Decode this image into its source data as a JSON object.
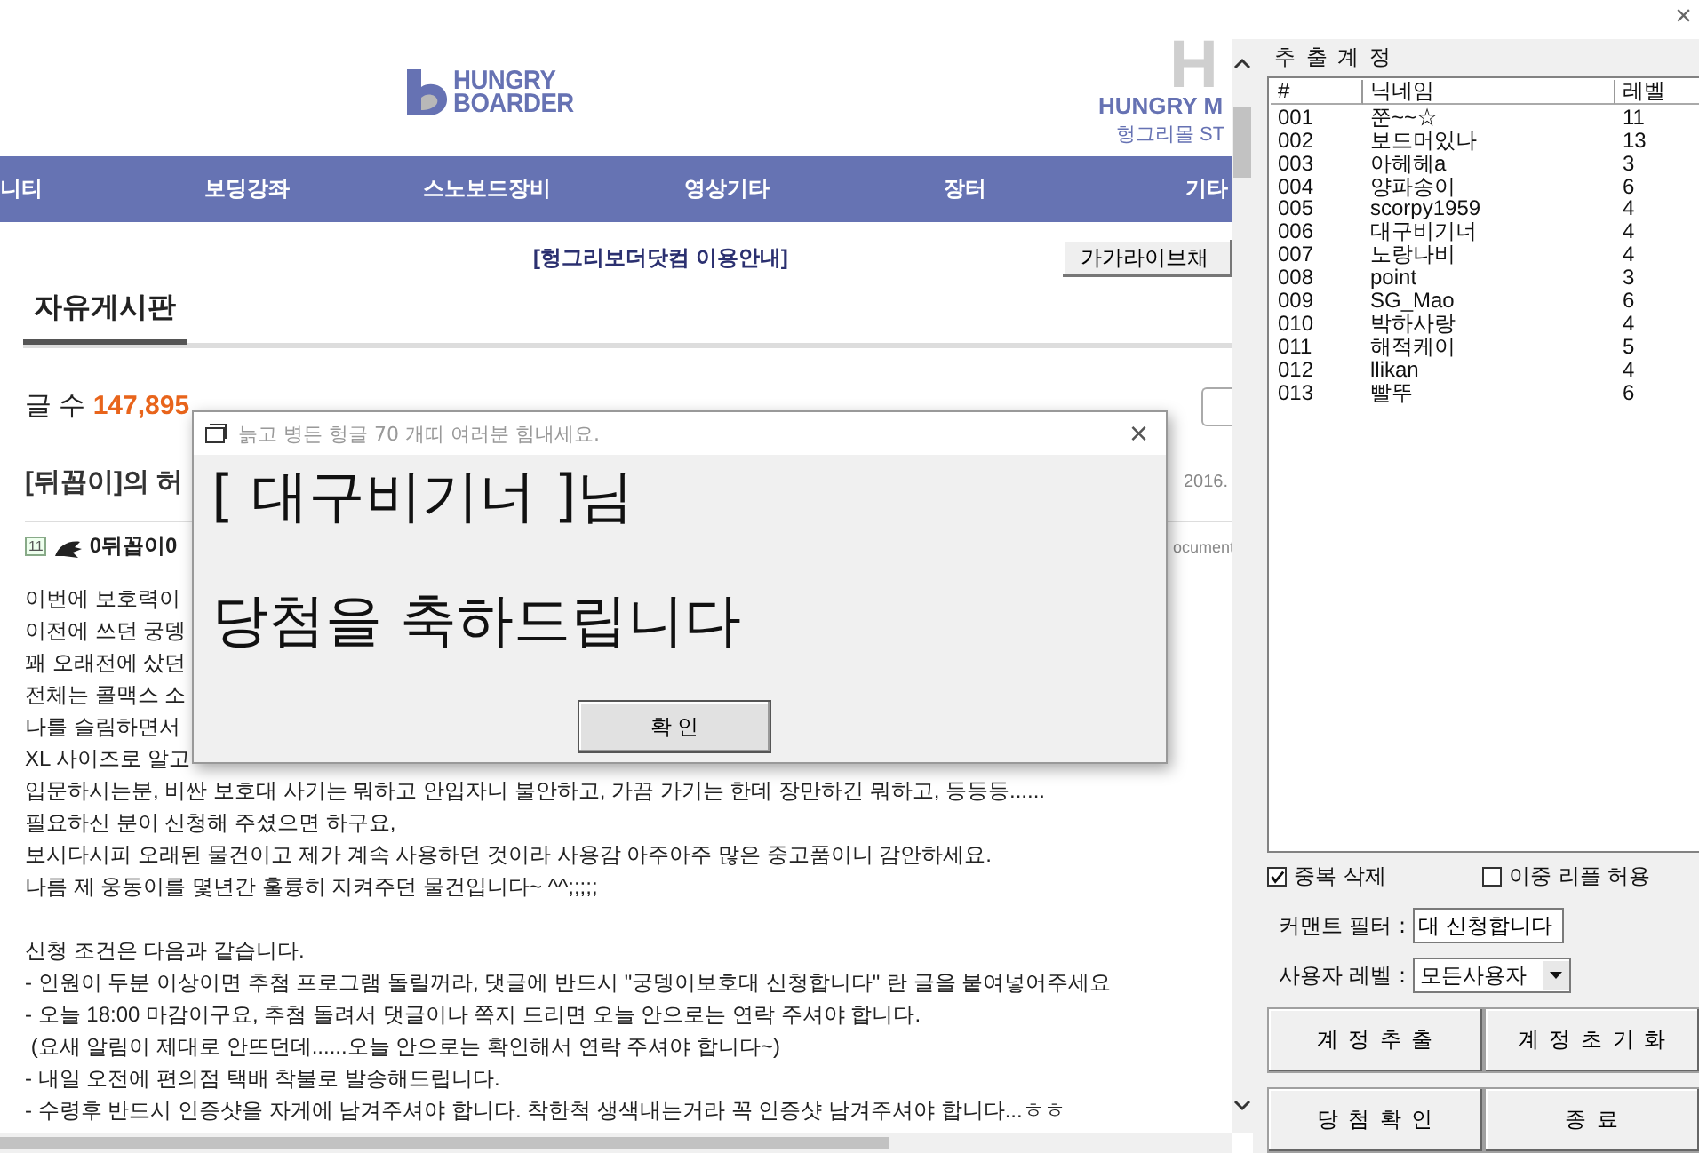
{
  "browser": {
    "logo": {
      "line1": "HUNGRY",
      "line2": "BOARDER"
    },
    "mall_logo": {
      "mark": "H",
      "line1": "HUNGRY M",
      "line2": "헝그리몰 ST"
    },
    "nav": [
      "니티",
      "보딩강좌",
      "스노보드장비",
      "영상기타",
      "장터",
      "기타"
    ],
    "notice_link": "[헝그리보더닷컴 이용안내]",
    "chat_button": "가가라이브채",
    "board_title": "자유게시판",
    "post_count_label": "글 수",
    "post_count": "147,895",
    "post": {
      "title": "[뒤꼽이]의 허",
      "date": "2016.",
      "level_badge": "11",
      "author": "0뒤꼽이0",
      "meta": "ocument",
      "paragraphs": [
        [
          "이번에 보호력이",
          "이전에 쓰던 궁뎅",
          "꽤 오래전에 샀던",
          "전체는 콜맥스 소",
          "나를 슬림하면서",
          "XL 사이즈로 알고",
          "입문하시는분, 비싼 보호대 사기는 뭐하고 안입자니 불안하고, 가끔 가기는 한데 장만하긴 뭐하고, 등등등......",
          "필요하신 분이 신청해 주셨으면 하구요,",
          "보시다시피 오래된 물건이고 제가 계속 사용하던 것이라 사용감 아주아주 많은 중고품이니 감안하세요.",
          "나름 제 웅동이를 몇년간 훌륭히 지켜주던 물건입니다~ ^^;;;;;"
        ],
        [
          "신청 조건은 다음과 같습니다.",
          "- 인원이 두분 이상이면 추첨 프로그램 돌릴꺼라, 댓글에 반드시 \"궁뎅이보호대 신청합니다\" 란 글을 붙여넣어주세요",
          "- 오늘 18:00 마감이구요, 추첨 돌려서 댓글이나 쪽지 드리면 오늘 안으로는 연락 주셔야 합니다.",
          " (요새 알림이 제대로 안뜨던데......오늘 안으로는 확인해서 연락 주셔야 합니다~)",
          "- 내일 오전에 편의점 택배 착불로 발송해드립니다.",
          "- 수령후 반드시 인증샷을 자게에 남겨주셔야 합니다. 착한척 생색내는거라 꼭 인증샷 남겨주셔야 합니다...ㅎㅎ"
        ]
      ]
    }
  },
  "dialog": {
    "title": "늙고 병든 헝글 70 개띠 여러분 힘내세요.",
    "close": "×",
    "winner_line": "[ 대구비기너 ]님",
    "message": "당첨을 축하드립니다",
    "ok_button": "확 인"
  },
  "panel": {
    "close": "×",
    "title": "추 출 계 정",
    "columns": [
      "#",
      "닉네임",
      "레벨"
    ],
    "rows": [
      [
        "001",
        "쭌~~☆",
        "11"
      ],
      [
        "002",
        "보드머있나",
        "13"
      ],
      [
        "003",
        "아헤헤a",
        "3"
      ],
      [
        "004",
        "양파송이",
        "6"
      ],
      [
        "005",
        "scorpy1959",
        "4"
      ],
      [
        "006",
        "대구비기너",
        "4"
      ],
      [
        "007",
        "노랑나비",
        "4"
      ],
      [
        "008",
        "point",
        "3"
      ],
      [
        "009",
        "SG_Mao",
        "6"
      ],
      [
        "010",
        "박하사랑",
        "4"
      ],
      [
        "011",
        "해적케이",
        "5"
      ],
      [
        "012",
        "llikan",
        "4"
      ],
      [
        "013",
        "빨뚜",
        "6"
      ]
    ],
    "options": [
      {
        "label": "중복 삭제",
        "checked": true
      },
      {
        "label": "이중 리플 허용",
        "checked": false
      }
    ],
    "filter": {
      "label": "커맨트 필터 :",
      "value": "대 신청합니다"
    },
    "level": {
      "label": "사용자 레벨 :",
      "value": "모든사용자"
    },
    "buttons": [
      "계 정 추 출",
      "계 정 초 기 화",
      "당 첨 확 인",
      "종 료"
    ]
  }
}
